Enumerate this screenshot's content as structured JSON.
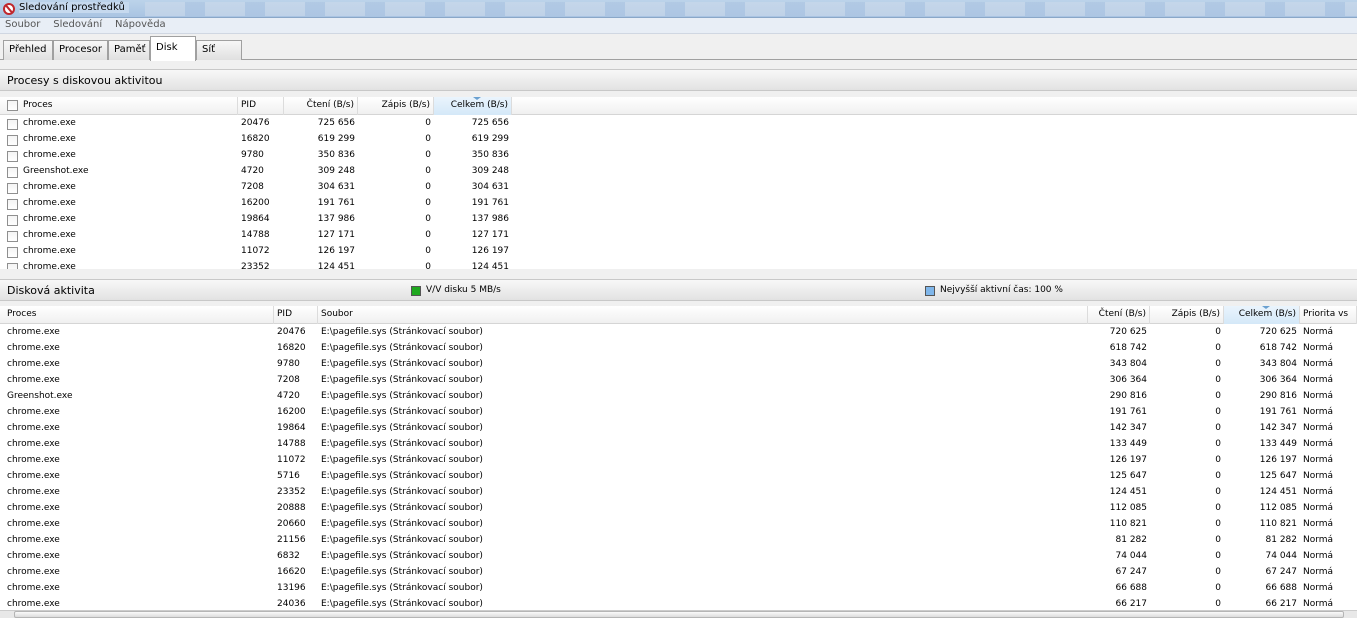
{
  "window": {
    "title": "Sledování prostředků"
  },
  "menu": [
    "Soubor",
    "Sledování",
    "Nápověda"
  ],
  "tabs": [
    "Přehled",
    "Procesor",
    "Paměť",
    "Disk",
    "Síť"
  ],
  "active_tab": "Disk",
  "processes": {
    "title": "Procesy s diskovou aktivitou",
    "columns": [
      "Proces",
      "PID",
      "Čtení (B/s)",
      "Zápis (B/s)",
      "Celkem (B/s)"
    ],
    "rows": [
      [
        "chrome.exe",
        "20476",
        "725 656",
        "0",
        "725 656"
      ],
      [
        "chrome.exe",
        "16820",
        "619 299",
        "0",
        "619 299"
      ],
      [
        "chrome.exe",
        "9780",
        "350 836",
        "0",
        "350 836"
      ],
      [
        "Greenshot.exe",
        "4720",
        "309 248",
        "0",
        "309 248"
      ],
      [
        "chrome.exe",
        "7208",
        "304 631",
        "0",
        "304 631"
      ],
      [
        "chrome.exe",
        "16200",
        "191 761",
        "0",
        "191 761"
      ],
      [
        "chrome.exe",
        "19864",
        "137 986",
        "0",
        "137 986"
      ],
      [
        "chrome.exe",
        "14788",
        "127 171",
        "0",
        "127 171"
      ],
      [
        "chrome.exe",
        "11072",
        "126 197",
        "0",
        "126 197"
      ],
      [
        "chrome.exe",
        "23352",
        "124 451",
        "0",
        "124 451"
      ]
    ]
  },
  "disk_activity": {
    "title": "Disková aktivita",
    "legend_io": "V/V disku 5 MB/s",
    "legend_io_color": "#1fa81f",
    "legend_active": "Nejvyšší aktivní čas: 100 %",
    "legend_active_color": "#7fb6ea",
    "columns": [
      "Proces",
      "PID",
      "Soubor",
      "Čtení (B/s)",
      "Zápis (B/s)",
      "Celkem (B/s)",
      "Priorita vs"
    ],
    "rows": [
      [
        "chrome.exe",
        "20476",
        "E:\\pagefile.sys (Stránkovací soubor)",
        "720 625",
        "0",
        "720 625",
        "Normá"
      ],
      [
        "chrome.exe",
        "16820",
        "E:\\pagefile.sys (Stránkovací soubor)",
        "618 742",
        "0",
        "618 742",
        "Normá"
      ],
      [
        "chrome.exe",
        "9780",
        "E:\\pagefile.sys (Stránkovací soubor)",
        "343 804",
        "0",
        "343 804",
        "Normá"
      ],
      [
        "chrome.exe",
        "7208",
        "E:\\pagefile.sys (Stránkovací soubor)",
        "306 364",
        "0",
        "306 364",
        "Normá"
      ],
      [
        "Greenshot.exe",
        "4720",
        "E:\\pagefile.sys (Stránkovací soubor)",
        "290 816",
        "0",
        "290 816",
        "Normá"
      ],
      [
        "chrome.exe",
        "16200",
        "E:\\pagefile.sys (Stránkovací soubor)",
        "191 761",
        "0",
        "191 761",
        "Normá"
      ],
      [
        "chrome.exe",
        "19864",
        "E:\\pagefile.sys (Stránkovací soubor)",
        "142 347",
        "0",
        "142 347",
        "Normá"
      ],
      [
        "chrome.exe",
        "14788",
        "E:\\pagefile.sys (Stránkovací soubor)",
        "133 449",
        "0",
        "133 449",
        "Normá"
      ],
      [
        "chrome.exe",
        "11072",
        "E:\\pagefile.sys (Stránkovací soubor)",
        "126 197",
        "0",
        "126 197",
        "Normá"
      ],
      [
        "chrome.exe",
        "5716",
        "E:\\pagefile.sys (Stránkovací soubor)",
        "125 647",
        "0",
        "125 647",
        "Normá"
      ],
      [
        "chrome.exe",
        "23352",
        "E:\\pagefile.sys (Stránkovací soubor)",
        "124 451",
        "0",
        "124 451",
        "Normá"
      ],
      [
        "chrome.exe",
        "20888",
        "E:\\pagefile.sys (Stránkovací soubor)",
        "112 085",
        "0",
        "112 085",
        "Normá"
      ],
      [
        "chrome.exe",
        "20660",
        "E:\\pagefile.sys (Stránkovací soubor)",
        "110 821",
        "0",
        "110 821",
        "Normá"
      ],
      [
        "chrome.exe",
        "21156",
        "E:\\pagefile.sys (Stránkovací soubor)",
        "81 282",
        "0",
        "81 282",
        "Normá"
      ],
      [
        "chrome.exe",
        "6832",
        "E:\\pagefile.sys (Stránkovací soubor)",
        "74 044",
        "0",
        "74 044",
        "Normá"
      ],
      [
        "chrome.exe",
        "16620",
        "E:\\pagefile.sys (Stránkovací soubor)",
        "67 247",
        "0",
        "67 247",
        "Normá"
      ],
      [
        "chrome.exe",
        "13196",
        "E:\\pagefile.sys (Stránkovací soubor)",
        "66 688",
        "0",
        "66 688",
        "Normá"
      ],
      [
        "chrome.exe",
        "24036",
        "E:\\pagefile.sys (Stránkovací soubor)",
        "66 217",
        "0",
        "66 217",
        "Normá"
      ]
    ]
  }
}
